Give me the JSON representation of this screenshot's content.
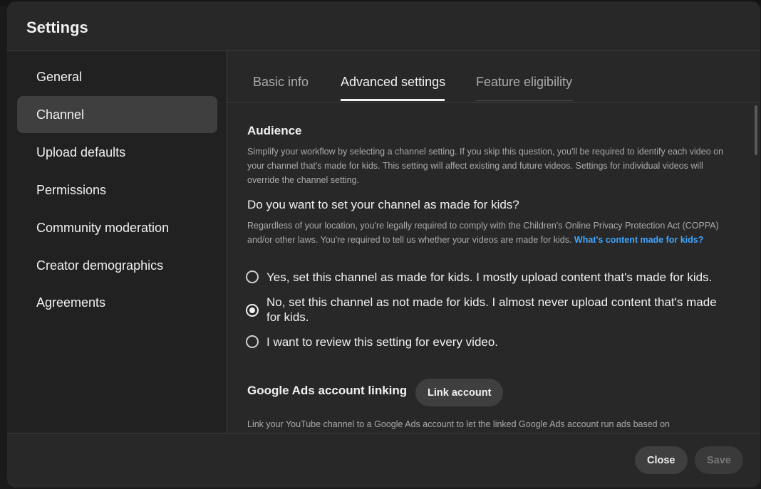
{
  "dialog": {
    "title": "Settings"
  },
  "sidebar": {
    "items": [
      {
        "label": "General"
      },
      {
        "label": "Channel"
      },
      {
        "label": "Upload defaults"
      },
      {
        "label": "Permissions"
      },
      {
        "label": "Community moderation"
      },
      {
        "label": "Creator demographics"
      },
      {
        "label": "Agreements"
      }
    ],
    "active": "Channel"
  },
  "tabs": [
    {
      "label": "Basic info"
    },
    {
      "label": "Advanced settings"
    },
    {
      "label": "Feature eligibility"
    }
  ],
  "active_tab": "Advanced settings",
  "audience": {
    "heading": "Audience",
    "description": "Simplify your workflow by selecting a channel setting. If you skip this question, you'll be required to identify each video on your channel that's made for kids. This setting will affect existing and future videos. Settings for individual videos will override the channel setting.",
    "question": "Do you want to set your channel as made for kids?",
    "legal_text": "Regardless of your location, you're legally required to comply with the Children's Online Privacy Protection Act (COPPA) and/or other laws. You're required to tell us whether your videos are made for kids.",
    "link_text": "What's content made for kids?",
    "options": [
      {
        "label": "Yes, set this channel as made for kids. I mostly upload content that's made for kids.",
        "checked": false
      },
      {
        "label": "No, set this channel as not made for kids. I almost never upload content that's made for kids.",
        "checked": true
      },
      {
        "label": "I want to review this setting for every video.",
        "checked": false
      }
    ]
  },
  "ads": {
    "heading": "Google Ads account linking",
    "button": "Link account",
    "description": "Link your YouTube channel to a Google Ads account to let the linked Google Ads account run ads based on"
  },
  "footer": {
    "close": "Close",
    "save": "Save"
  },
  "colors": {
    "background": "#282828",
    "sidebar": "#212121",
    "accent_link": "#3ea6ff",
    "active_item": "#3f3f3f"
  }
}
